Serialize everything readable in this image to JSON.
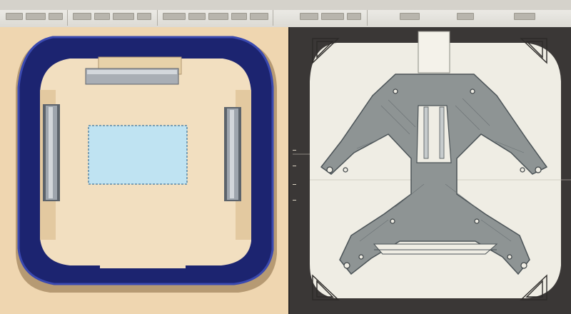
{
  "toolbar": {
    "buttons": [
      "tool-1",
      "tool-2",
      "tool-3",
      "tool-4",
      "tool-5",
      "tool-6",
      "tool-7",
      "tool-8",
      "tool-9",
      "tool-10",
      "tool-11",
      "tool-12",
      "tool-13",
      "tool-14",
      "tool-15",
      "tool-16",
      "tool-17",
      "tool-18"
    ]
  },
  "colors": {
    "left_background": "#efd6b0",
    "tray_outline": "#1c2470",
    "tray_inner": "#f2dfc0",
    "blue_rect": "#bfe3f2",
    "right_background": "#3a3736",
    "drawing_sheet": "#efede4",
    "part_fill": "#8e9494"
  },
  "left_view": {
    "icons": [
      "tray-icon",
      "slot-bar-icon",
      "label-rect-icon"
    ]
  },
  "right_view": {
    "icons": [
      "corner-mark-icon",
      "x-frame-part-icon"
    ]
  }
}
